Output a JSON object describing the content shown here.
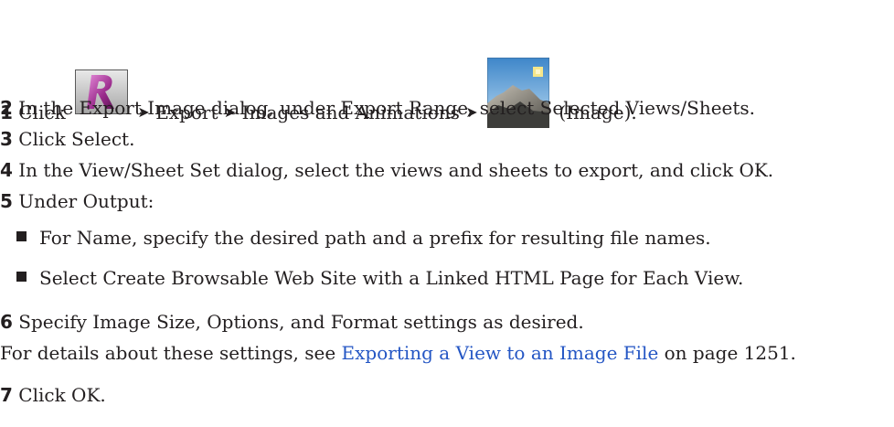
{
  "steps": [
    {
      "num": "1",
      "pre": "Click",
      "mid1": "Export",
      "mid2": "Images and Animations",
      "post": "(Image)."
    },
    {
      "num": "2",
      "text": "In the Export Image dialog, under Export Range, select Selected Views/Sheets."
    },
    {
      "num": "3",
      "text": "Click Select."
    },
    {
      "num": "4",
      "text": "In the View/Sheet Set dialog, select the views and sheets to export, and click OK."
    },
    {
      "num": "5",
      "text": "Under Output:"
    },
    {
      "num": "6",
      "text": "Specify Image Size, Options, and Format settings as desired."
    },
    {
      "num": "7",
      "text": "Click OK."
    }
  ],
  "bullets": [
    "For Name, specify the desired path and a prefix for resulting file names.",
    "Select Create Browsable Web Site with a Linked HTML Page for Each View."
  ],
  "arrow": "➤",
  "details": {
    "pre": "For details about these settings, see",
    "link": "Exporting a View to an Image File",
    "post": "on page 1251."
  },
  "icons": {
    "app": "application-menu-icon",
    "image": "image-export-icon"
  }
}
